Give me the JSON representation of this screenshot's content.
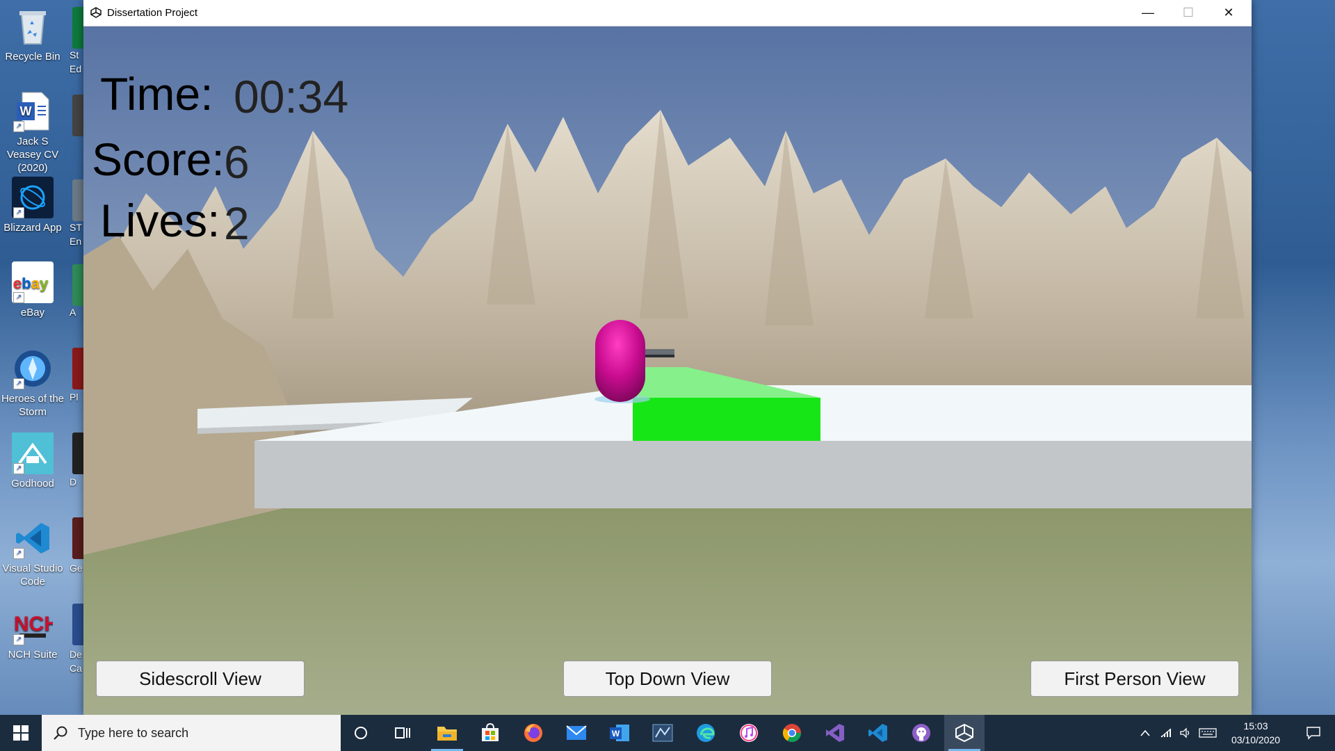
{
  "desktop": {
    "icons": [
      {
        "name": "recycle-bin",
        "label": "Recycle Bin"
      },
      {
        "name": "word-cv",
        "label": "Jack S Veasey CV (2020)"
      },
      {
        "name": "blizzard-app",
        "label": "Blizzard App"
      },
      {
        "name": "ebay",
        "label": "eBay"
      },
      {
        "name": "heroes-of-the-storm",
        "label": "Heroes of the Storm"
      },
      {
        "name": "godhood",
        "label": "Godhood"
      },
      {
        "name": "visual-studio-code",
        "label": "Visual Studio Code"
      },
      {
        "name": "nch-suite",
        "label": "NCH Suite"
      }
    ],
    "col2_labels": [
      "St",
      "Ed",
      "ST",
      "En",
      "A",
      "Pl",
      "D",
      "Ge",
      "De",
      "Ca"
    ]
  },
  "window": {
    "title": "Dissertation Project",
    "minimize": "—",
    "maximize": "☐",
    "close": "✕"
  },
  "hud": {
    "time_label": "Time:",
    "time_value": "00:34",
    "score_label": "Score:",
    "score_value": "6",
    "lives_label": "Lives:",
    "lives_value": "2"
  },
  "buttons": {
    "sidescroll": "Sidescroll View",
    "topdown": "Top Down View",
    "firstperson": "First Person View"
  },
  "taskbar": {
    "search_placeholder": "Type here to search",
    "apps": [
      "cortana",
      "task-view",
      "file-explorer",
      "microsoft-store",
      "firefox",
      "mail",
      "word",
      "sql-server",
      "edge",
      "itunes",
      "chrome",
      "visual-studio",
      "vscode",
      "github-desktop",
      "unity"
    ],
    "clock_time": "15:03",
    "clock_date": "03/10/2020"
  },
  "colors": {
    "player": "#d0109a",
    "platform_green": "#16e616",
    "platform_white": "#f4f9fb",
    "platform_grey": "#c3c6c8",
    "taskbar": "#1c2c3f"
  }
}
